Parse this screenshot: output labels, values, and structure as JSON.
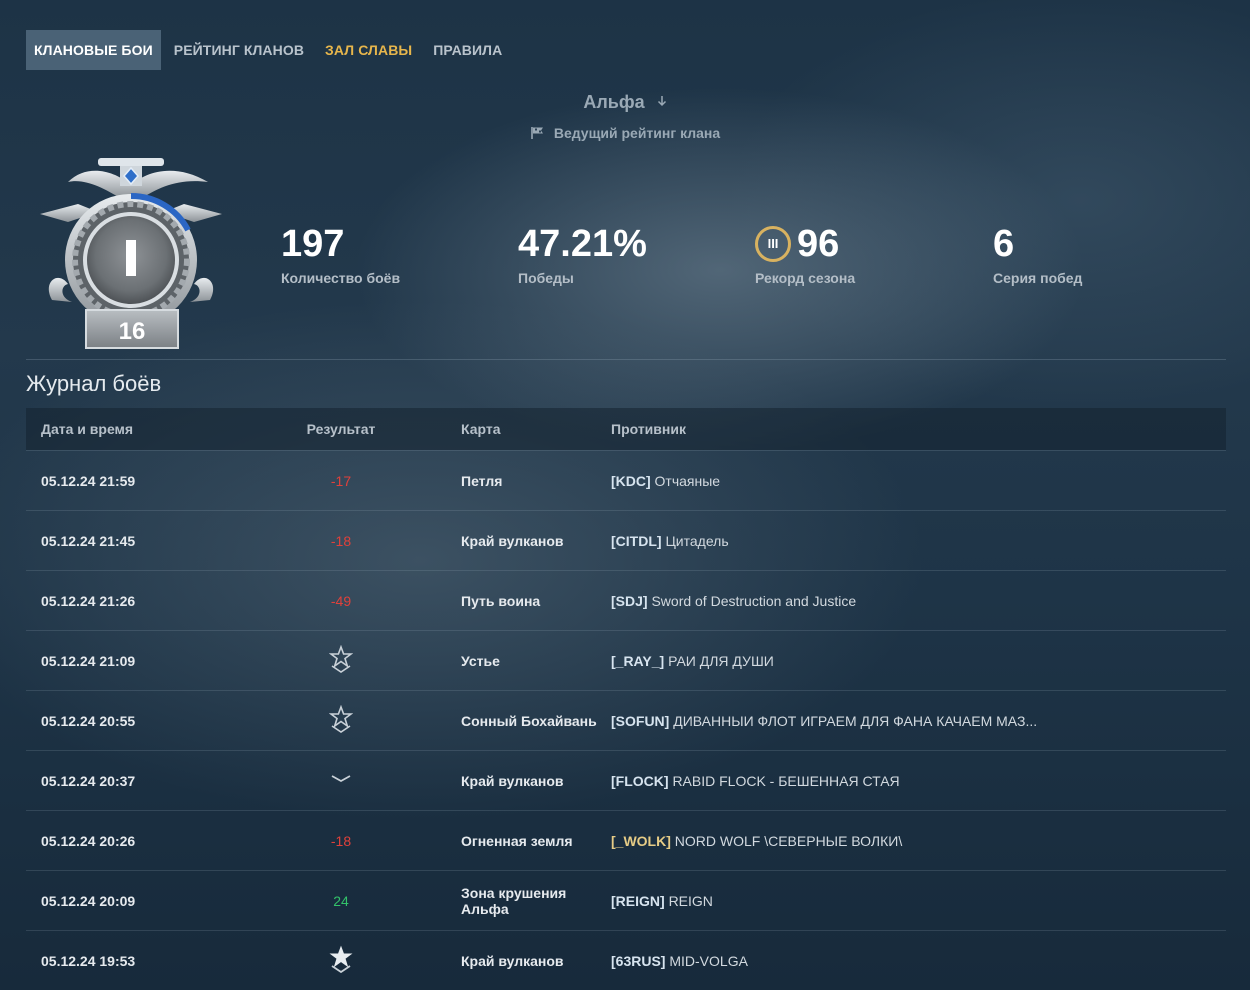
{
  "nav": {
    "tabs": [
      {
        "label": "КЛАНОВЫЕ БОИ"
      },
      {
        "label": "РЕЙТИНГ КЛАНОВ"
      },
      {
        "label": "ЗАЛ СЛАВЫ"
      },
      {
        "label": "ПРАВИЛА"
      }
    ]
  },
  "league": {
    "name": "Альфа",
    "subtitle": "Ведущий рейтинг клана"
  },
  "badge": {
    "division": "I",
    "number": "16"
  },
  "stats": [
    {
      "value": "197",
      "label": "Количество боёв"
    },
    {
      "value": "47.21%",
      "label": "Победы"
    },
    {
      "value": "96",
      "rank": "III",
      "label": "Рекорд сезона"
    },
    {
      "value": "6",
      "label": "Серия побед"
    }
  ],
  "log": {
    "title": "Журнал боёв",
    "headers": [
      "Дата и время",
      "Результат",
      "Карта",
      "Противник"
    ],
    "rows": [
      {
        "date": "05.12.24 21:59",
        "result": "-17",
        "result_type": "neg",
        "map": "Петля",
        "tag": "[KDC]",
        "tag_gold": false,
        "opponent": "Отчаяные"
      },
      {
        "date": "05.12.24 21:45",
        "result": "-18",
        "result_type": "neg",
        "map": "Край вулканов",
        "tag": "[CITDL]",
        "tag_gold": false,
        "opponent": "Цитадель"
      },
      {
        "date": "05.12.24 21:26",
        "result": "-49",
        "result_type": "neg",
        "map": "Путь воина",
        "tag": "[SDJ]",
        "tag_gold": false,
        "opponent": "Sword of Destruction and Justice"
      },
      {
        "date": "05.12.24 21:09",
        "result": "",
        "result_type": "star-outline",
        "map": "Устье",
        "tag": "[_RAY_]",
        "tag_gold": false,
        "opponent": "РАИ ДЛЯ ДУШИ"
      },
      {
        "date": "05.12.24 20:55",
        "result": "",
        "result_type": "star-outline",
        "map": "Сонный Бохайвань",
        "tag": "[SOFUN]",
        "tag_gold": false,
        "opponent": "ДИВАННЫИ ФЛОТ ИГРАЕМ ДЛЯ ФАНА КАЧАЕМ МАЗ..."
      },
      {
        "date": "05.12.24 20:37",
        "result": "",
        "result_type": "chevron",
        "map": "Край вулканов",
        "tag": "[FLOCK]",
        "tag_gold": false,
        "opponent": "RABID FLOCK - БЕШЕННАЯ СТАЯ"
      },
      {
        "date": "05.12.24 20:26",
        "result": "-18",
        "result_type": "neg",
        "map": "Огненная земля",
        "tag": "[_WOLK]",
        "tag_gold": true,
        "opponent": "NORD WOLF \\СЕВЕРНЫЕ ВОЛКИ\\"
      },
      {
        "date": "05.12.24 20:09",
        "result": "24",
        "result_type": "pos",
        "map": "Зона крушения Альфа",
        "tag": "[REIGN]",
        "tag_gold": false,
        "opponent": "REIGN"
      },
      {
        "date": "05.12.24 19:53",
        "result": "",
        "result_type": "star-filled",
        "map": "Край вулканов",
        "tag": "[63RUS]",
        "tag_gold": false,
        "opponent": "MID-VOLGA"
      }
    ]
  },
  "colors": {
    "accent_gold": "#e7b64c",
    "loss": "#e0413b",
    "win": "#33c26a",
    "active_tab": "#4a6276"
  },
  "icons": [
    "flag-icon",
    "arrow-down-icon",
    "star-outline-icon",
    "star-filled-icon",
    "chevron-down-icon",
    "clan-rating-badge"
  ]
}
